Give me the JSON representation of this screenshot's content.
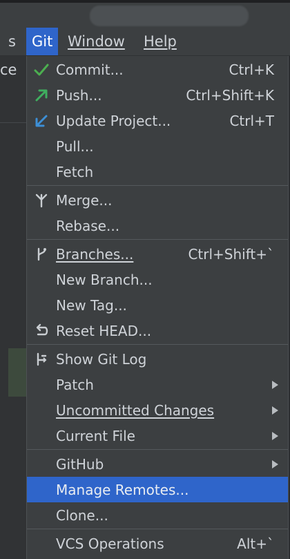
{
  "menubar": {
    "items": [
      {
        "label": "s"
      },
      {
        "label": "Git"
      },
      {
        "label": "Window"
      },
      {
        "label": "Help"
      }
    ]
  },
  "left": {
    "partial_text": "ce"
  },
  "git_menu": {
    "items": [
      {
        "label": "Commit...",
        "shortcut": "Ctrl+K",
        "icon": "check-icon"
      },
      {
        "label": "Push...",
        "shortcut": "Ctrl+Shift+K",
        "icon": "push-arrow-icon"
      },
      {
        "label": "Update Project...",
        "shortcut": "Ctrl+T",
        "icon": "update-arrow-icon"
      },
      {
        "label": "Pull..."
      },
      {
        "label": "Fetch"
      },
      {
        "label": "Merge...",
        "icon": "merge-icon"
      },
      {
        "label": "Rebase..."
      },
      {
        "label": "Branches...",
        "shortcut": "Ctrl+Shift+`",
        "icon": "branch-icon"
      },
      {
        "label": "New Branch..."
      },
      {
        "label": "New Tag..."
      },
      {
        "label": "Reset HEAD...",
        "icon": "undo-icon"
      },
      {
        "label": "Show Git Log",
        "icon": "git-log-icon"
      },
      {
        "label": "Patch",
        "submenu": true
      },
      {
        "label": "Uncommitted Changes",
        "submenu": true
      },
      {
        "label": "Current File",
        "submenu": true
      },
      {
        "label": "GitHub",
        "submenu": true
      },
      {
        "label": "Manage Remotes...",
        "selected": true
      },
      {
        "label": "Clone..."
      },
      {
        "label": "VCS Operations",
        "shortcut": "Alt+`"
      }
    ]
  },
  "colors": {
    "menu_bg": "#3c3f41",
    "selection": "#2f65ca",
    "check_green": "#4caf50",
    "push_green": "#3fae5f",
    "update_blue": "#3d8fd6"
  }
}
